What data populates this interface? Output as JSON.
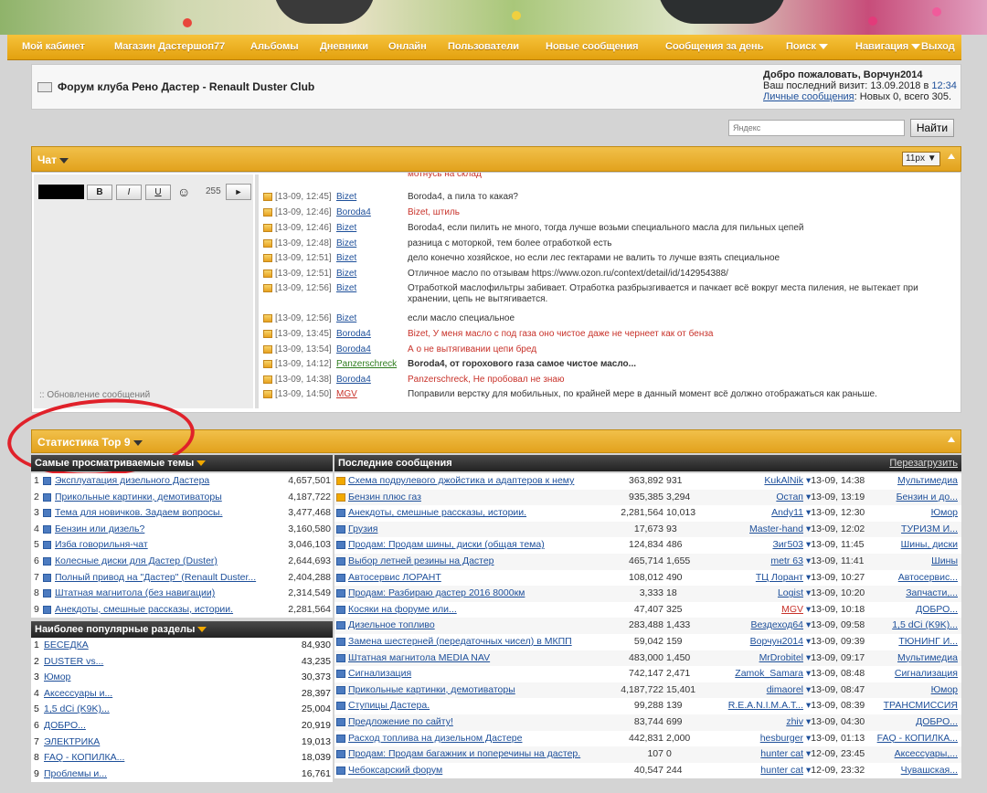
{
  "nav": {
    "items": [
      "Мой кабинет",
      "Магазин Дастершоп77",
      "Альбомы",
      "Дневники",
      "Онлайн",
      "Пользователи",
      "Новые сообщения",
      "Сообщения за день",
      "Поиск",
      "Навигация",
      "Выход"
    ]
  },
  "header": {
    "forum_title": "Форум клуба Рено Дастер - Renault Duster Club",
    "welcome": "Добро пожаловать, Ворчун2014",
    "last_visit_label": "Ваш последний визит: 13.09.2018 в",
    "last_visit_time": "12:34",
    "pm_link": "Личные сообщения",
    "pm_text": ": Новых 0, всего 305."
  },
  "search": {
    "placeholder": "Яндекс",
    "button": "Найти"
  },
  "chat": {
    "title": "Чат",
    "font_size": "11px ▼",
    "editor": {
      "bold": "B",
      "italic": "I",
      "underline": "U",
      "smile": "☺",
      "counter": "255",
      "send": "►"
    },
    "update_label": ":: Обновление сообщений",
    "top_partial": "мотнусь на склад",
    "messages": [
      {
        "time": "[13-09, 12:45]",
        "user": "Bizet",
        "text": "Boroda4, а пила то какая?",
        "style": ""
      },
      {
        "time": "[13-09, 12:46]",
        "user": "Boroda4",
        "text": "Bizet, штиль",
        "style": "red"
      },
      {
        "time": "[13-09, 12:46]",
        "user": "Bizet",
        "text": "Boroda4, если пилить не много, тогда лучше возьми специального масла для пильных цепей",
        "style": ""
      },
      {
        "time": "[13-09, 12:48]",
        "user": "Bizet",
        "text": "разница с моторкой, тем более отработкой есть",
        "style": ""
      },
      {
        "time": "[13-09, 12:51]",
        "user": "Bizet",
        "text": "дело конечно хозяйское, но если лес гектарами не валить то лучше взять специальное",
        "style": ""
      },
      {
        "time": "[13-09, 12:51]",
        "user": "Bizet",
        "text": "Отличное масло по отзывам https://www.ozon.ru/context/detail/id/142954388/",
        "style": ""
      },
      {
        "time": "[13-09, 12:56]",
        "user": "Bizet",
        "text": "Отработкой маслофильтры забивает. Отработка разбрызгивается и пачкает всё вокруг места пиления, не вытекает при хранении, цепь не вытягивается.",
        "style": ""
      },
      {
        "time": "[13-09, 12:56]",
        "user": "Bizet",
        "text": "если масло специальное",
        "style": ""
      },
      {
        "time": "[13-09, 13:45]",
        "user": "Boroda4",
        "text": "Bizet, У меня масло с под газа оно чистое даже не чернеет как от бенза",
        "style": "red"
      },
      {
        "time": "[13-09, 13:54]",
        "user": "Boroda4",
        "text": "А о не вытягивании цепи бред",
        "style": "red"
      },
      {
        "time": "[13-09, 14:12]",
        "user": "Panzerschreck",
        "text": "Boroda4, от горохового газа самое чистое масло...",
        "style": "bold"
      },
      {
        "time": "[13-09, 14:38]",
        "user": "Boroda4",
        "text": "Panzerschreck, Не пробовал не знаю",
        "style": "red"
      },
      {
        "time": "[13-09, 14:50]",
        "user": "MGV",
        "text": "Поправили верстку для мобильных, по крайней мере в данный момент всё должно отображаться как раньше.",
        "style": ""
      }
    ]
  },
  "stats": {
    "title": "Статистика Top 9",
    "most_viewed_title": "Самые просматриваемые темы",
    "most_viewed": [
      {
        "n": "1",
        "title": "Эксплуатация дизельного Дастера",
        "views": "4,657,501"
      },
      {
        "n": "2",
        "title": "Прикольные картинки, демотиваторы",
        "views": "4,187,722"
      },
      {
        "n": "3",
        "title": "Тема для новичков. Задаем вопросы.",
        "views": "3,477,468"
      },
      {
        "n": "4",
        "title": "Бензин или дизель?",
        "views": "3,160,580"
      },
      {
        "n": "5",
        "title": "Изба говорильня-чат",
        "views": "3,046,103"
      },
      {
        "n": "6",
        "title": "Колесные диски для Дастер (Duster)",
        "views": "2,644,693"
      },
      {
        "n": "7",
        "title": "Полный привод на \"Дастер\" (Renault Duster...",
        "views": "2,404,288"
      },
      {
        "n": "8",
        "title": "Штатная магнитола (без навигации)",
        "views": "2,314,549"
      },
      {
        "n": "9",
        "title": "Анекдоты, смешные рассказы, истории.",
        "views": "2,281,564"
      }
    ],
    "popular_sections_title": "Наиболее популярные разделы",
    "popular_sections": [
      {
        "n": "1",
        "title": "БЕСЕДКА",
        "count": "84,930"
      },
      {
        "n": "2",
        "title": "DUSTER vs...",
        "count": "43,235"
      },
      {
        "n": "3",
        "title": "Юмор",
        "count": "30,373"
      },
      {
        "n": "4",
        "title": "Аксессуары и...",
        "count": "28,397"
      },
      {
        "n": "5",
        "title": "1,5 dCi (K9K)...",
        "count": "25,004"
      },
      {
        "n": "6",
        "title": "ДОБРО...",
        "count": "20,919"
      },
      {
        "n": "7",
        "title": "ЭЛЕКТРИКА",
        "count": "19,013"
      },
      {
        "n": "8",
        "title": "FAQ - КОПИЛКА...",
        "count": "18,039"
      },
      {
        "n": "9",
        "title": "Проблемы и...",
        "count": "16,761"
      }
    ],
    "latest_title": "Последние сообщения",
    "reload": "Перезагрузить",
    "latest": [
      {
        "title": "Схема подрулевого джойстика и адаптеров к нему",
        "views": "363,892",
        "replies": "931",
        "author": "KukAlNik",
        "date": "13-09, 14:38",
        "forum": "Мультимедиа",
        "hot": true,
        "red": false
      },
      {
        "title": "Бензин плюс газ",
        "views": "935,385",
        "replies": "3,294",
        "author": "Остап",
        "date": "13-09, 13:19",
        "forum": "Бензин и до...",
        "hot": true,
        "red": false
      },
      {
        "title": "Анекдоты, смешные рассказы, истории.",
        "views": "2,281,564",
        "replies": "10,013",
        "author": "Andy11",
        "date": "13-09, 12:30",
        "forum": "Юмор",
        "hot": false,
        "red": false
      },
      {
        "title": "Грузия",
        "views": "17,673",
        "replies": "93",
        "author": "Master-hand",
        "date": "13-09, 12:02",
        "forum": "ТУРИЗМ И...",
        "hot": false,
        "red": false
      },
      {
        "title": "Продам: Продам шины, диски (общая тема)",
        "views": "124,834",
        "replies": "486",
        "author": "Зиг503",
        "date": "13-09, 11:45",
        "forum": "Шины, диски",
        "hot": false,
        "red": false
      },
      {
        "title": "Выбор летней резины на Дастер",
        "views": "465,714",
        "replies": "1,655",
        "author": "metr 63",
        "date": "13-09, 11:41",
        "forum": "Шины",
        "hot": false,
        "red": false
      },
      {
        "title": "Автосервис ЛОРАНТ",
        "views": "108,012",
        "replies": "490",
        "author": "ТЦ Лорант",
        "date": "13-09, 10:27",
        "forum": "Автосервис...",
        "hot": false,
        "red": false
      },
      {
        "title": "Продам: Разбираю дастер 2016 8000км",
        "views": "3,333",
        "replies": "18",
        "author": "Logist",
        "date": "13-09, 10:20",
        "forum": "Запчасти,...",
        "hot": false,
        "red": false
      },
      {
        "title": "Косяки на форуме или...",
        "views": "47,407",
        "replies": "325",
        "author": "MGV",
        "date": "13-09, 10:18",
        "forum": "ДОБРО...",
        "hot": false,
        "red": true
      },
      {
        "title": "Дизельное топливо",
        "views": "283,488",
        "replies": "1,433",
        "author": "Вездеход64",
        "date": "13-09, 09:58",
        "forum": "1,5 dCi (K9K)...",
        "hot": false,
        "red": false
      },
      {
        "title": "Замена шестерней (передаточных чисел) в МКПП",
        "views": "59,042",
        "replies": "159",
        "author": "Ворчун2014",
        "date": "13-09, 09:39",
        "forum": "ТЮНИНГ И...",
        "hot": false,
        "red": false
      },
      {
        "title": "Штатная магнитола MEDIA NAV",
        "views": "483,000",
        "replies": "1,450",
        "author": "MrDrobitel",
        "date": "13-09, 09:17",
        "forum": "Мультимедиа",
        "hot": false,
        "red": false
      },
      {
        "title": "Сигнализация",
        "views": "742,147",
        "replies": "2,471",
        "author": "Zamok_Samara",
        "date": "13-09, 08:48",
        "forum": "Сигнализация",
        "hot": false,
        "red": false
      },
      {
        "title": "Прикольные картинки, демотиваторы",
        "views": "4,187,722",
        "replies": "15,401",
        "author": "dimaorel",
        "date": "13-09, 08:47",
        "forum": "Юмор",
        "hot": false,
        "red": false
      },
      {
        "title": "Ступицы Дастера.",
        "views": "99,288",
        "replies": "139",
        "author": "R.E.A.N.I.M.A.T...",
        "date": "13-09, 08:39",
        "forum": "ТРАНСМИССИЯ",
        "hot": false,
        "red": false
      },
      {
        "title": "Предложение по сайту!",
        "views": "83,744",
        "replies": "699",
        "author": "zhiv",
        "date": "13-09, 04:30",
        "forum": "ДОБРО...",
        "hot": false,
        "red": false
      },
      {
        "title": "Расход топлива на дизельном Дастере",
        "views": "442,831",
        "replies": "2,000",
        "author": "hesburger",
        "date": "13-09, 01:13",
        "forum": "FAQ - КОПИЛКА...",
        "hot": false,
        "red": false
      },
      {
        "title": "Продам: Продам багажник и поперечины на дастер.",
        "views": "107",
        "replies": "0",
        "author": "hunter cat",
        "date": "12-09, 23:45",
        "forum": "Аксессуары,...",
        "hot": false,
        "red": false
      },
      {
        "title": "Чебоксарский форум",
        "views": "40,547",
        "replies": "244",
        "author": "hunter cat",
        "date": "12-09, 23:32",
        "forum": "Чувашская...",
        "hot": false,
        "red": false
      }
    ]
  },
  "colors": {
    "accent": "#e3a10f",
    "link": "#1d4f9a",
    "red_annotation": "#e0212a"
  }
}
